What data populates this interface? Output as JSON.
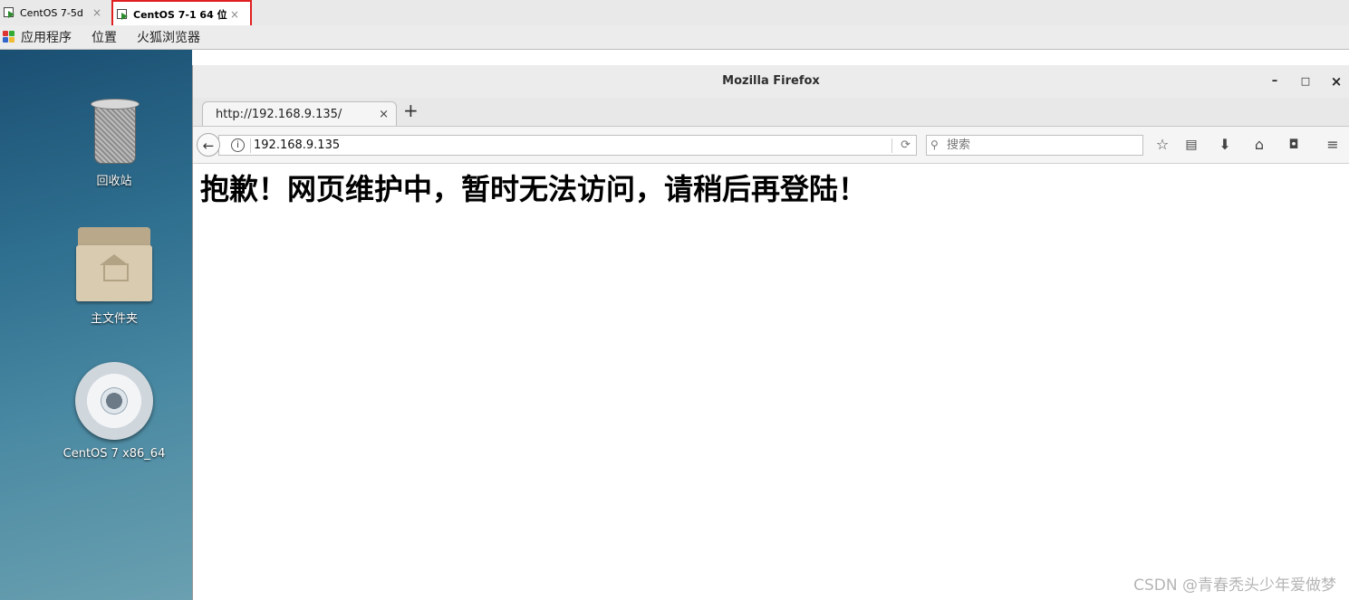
{
  "vm_tabs": [
    {
      "label": "CentOS 7-5d",
      "close": "×"
    },
    {
      "label": "CentOS 7-1 64 位",
      "close": "×"
    }
  ],
  "gnome_bar": {
    "applications": "应用程序",
    "places": "位置",
    "firefox": "火狐浏览器"
  },
  "desktop_icons": [
    {
      "label": "回收站",
      "icon": "trash-icon"
    },
    {
      "label": "主文件夹",
      "icon": "home-folder-icon"
    },
    {
      "label": "CentOS 7 x86_64",
      "icon": "disc-icon"
    }
  ],
  "firefox": {
    "window_title": "Mozilla Firefox",
    "minimize": "–",
    "maximize": "□",
    "close": "×",
    "tab_label": "http://192.168.9.135/",
    "tab_close": "×",
    "new_tab": "+",
    "url": "192.168.9.135",
    "search_placeholder": "搜索",
    "page_heading": "抱歉！网页维护中，暂时无法访问，请稍后再登陆！"
  },
  "watermark": "CSDN @青春秃头少年爱做梦",
  "colors": {
    "selected_tab_border": "#e02020",
    "desktop_bg": "#2f6f8f"
  }
}
